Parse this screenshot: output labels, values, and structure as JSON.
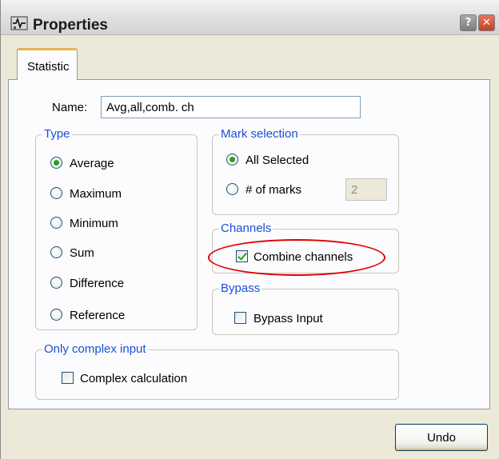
{
  "window": {
    "title": "Properties",
    "help_glyph": "?",
    "close_glyph": "✕"
  },
  "tabs": [
    {
      "label": "Statistic",
      "active": true
    }
  ],
  "name_field": {
    "label": "Name:",
    "value": "Avg,all,comb. ch"
  },
  "type_group": {
    "title": "Type",
    "options": [
      {
        "label": "Average",
        "checked": true
      },
      {
        "label": "Maximum",
        "checked": false
      },
      {
        "label": "Minimum",
        "checked": false
      },
      {
        "label": "Sum",
        "checked": false
      },
      {
        "label": "Difference",
        "checked": false
      },
      {
        "label": "Reference",
        "checked": false
      }
    ]
  },
  "mark_selection": {
    "title": "Mark selection",
    "all_selected_label": "All Selected",
    "all_selected_checked": true,
    "num_marks_label": "# of marks",
    "num_marks_checked": false,
    "num_marks_value": "2"
  },
  "channels": {
    "title": "Channels",
    "combine_label": "Combine channels",
    "combine_checked": true
  },
  "bypass": {
    "title": "Bypass",
    "bypass_label": "Bypass Input",
    "bypass_checked": false
  },
  "complex_input": {
    "title": "Only complex input",
    "complex_label": "Complex calculation",
    "complex_checked": false
  },
  "buttons": {
    "undo_label": "Undo"
  },
  "colors": {
    "groupbox_title": "#1b4fd1",
    "annotation_ellipse": "#e00000",
    "tab_accent": "#e5b350"
  }
}
